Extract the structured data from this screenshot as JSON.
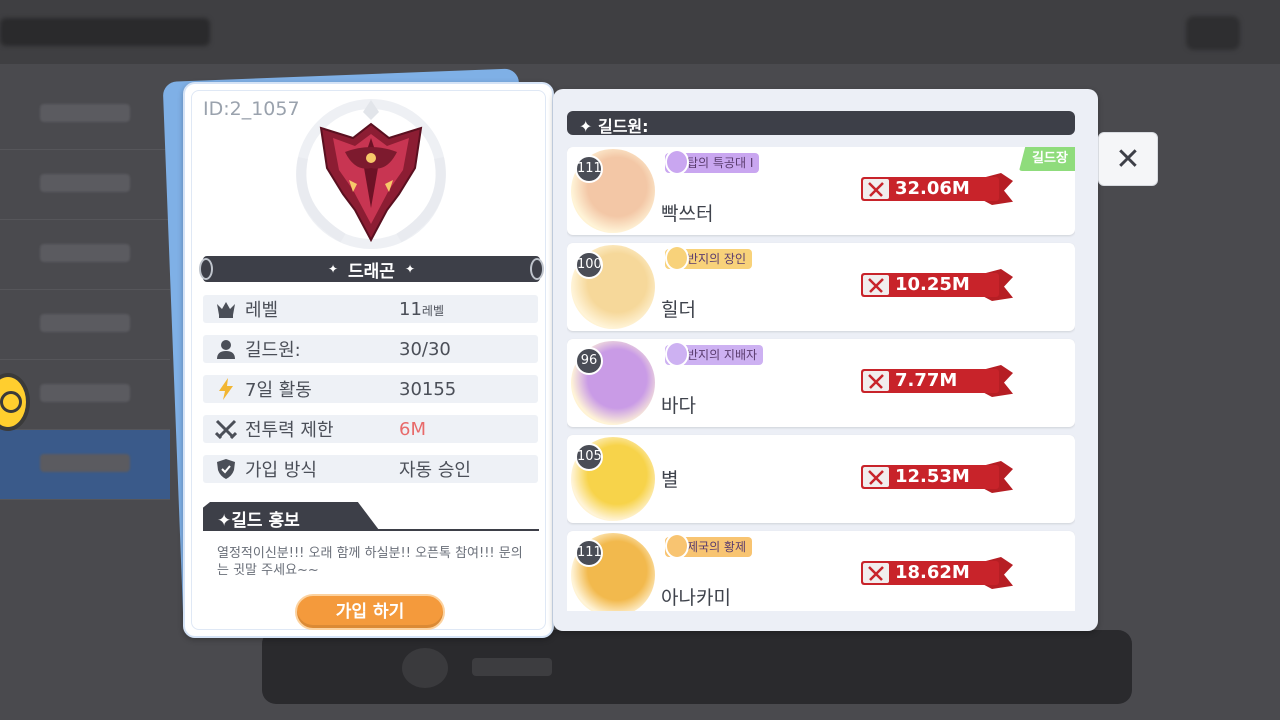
{
  "guild": {
    "id": "ID:2_1057",
    "name": "드래곤",
    "name_deco_left": "✦",
    "name_deco_right": "✦",
    "stats": [
      {
        "icon": "crown-icon",
        "label": "레벨",
        "value": "11",
        "unit": "레벨"
      },
      {
        "icon": "person-icon",
        "label": "길드원:",
        "value": "30/30",
        "unit": ""
      },
      {
        "icon": "lightning-icon",
        "label": "7일 활동",
        "value": "30155",
        "unit": ""
      },
      {
        "icon": "swords-icon",
        "label": "전투력 제한",
        "value": "6M",
        "unit": ""
      },
      {
        "icon": "shield-icon",
        "label": "가입 방식",
        "value": "자동 승인",
        "unit": ""
      }
    ],
    "promo_title": "✦길드 홍보",
    "promo_text": "열정적이신분!!! 오래 함께 하실분!! 오픈톡 참여!!! 문의는 귓말 주세요~~",
    "join_label": "가입 하기"
  },
  "members_panel": {
    "header": "✦ 길드원:",
    "leader_label": "길드장",
    "members": [
      {
        "level": "111",
        "title": "탑의 특공대 I",
        "name": "빡쓰터",
        "power": "32.06M",
        "leader": true,
        "title_color": "#c9a6f0",
        "avatar_color": "#f3c7a6"
      },
      {
        "level": "100",
        "title": "반지의 장인",
        "name": "힐더",
        "power": "10.25M",
        "leader": false,
        "title_color": "#f8d27a",
        "avatar_color": "#f6d89a"
      },
      {
        "level": "96",
        "title": "반지의 지배자",
        "name": "바다",
        "power": "7.77M",
        "leader": false,
        "title_color": "#cdb1f2",
        "avatar_color": "#c99be6"
      },
      {
        "level": "105",
        "title": "",
        "name": "별",
        "power": "12.53M",
        "leader": false,
        "title_color": "",
        "avatar_color": "#f7d34a"
      },
      {
        "level": "111",
        "title": "제국의 황제",
        "name": "아나카미",
        "power": "18.62M",
        "leader": false,
        "title_color": "#f8c471",
        "avatar_color": "#f2b94d"
      }
    ]
  },
  "close_symbol": "✕"
}
